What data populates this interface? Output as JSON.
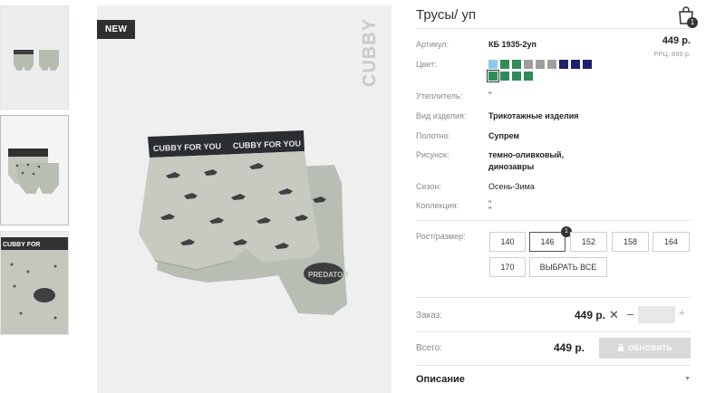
{
  "product": {
    "title": "Трусы/ уп",
    "badge": "NEW",
    "brand_watermark": "CUBBY",
    "waistband_text": "CUBBY FOR YOU",
    "print_badge": "PREDATOR",
    "price": "449 р.",
    "rrp": "РРЦ: 899 р.",
    "cart_count": "1"
  },
  "specs": [
    {
      "label": "Артикул:",
      "value": "КБ 1935-2уп",
      "bold": true
    },
    {
      "label": "Цвет:",
      "value": ""
    },
    {
      "label": "Утеплитель:",
      "value": "\""
    },
    {
      "label": "Вид изделия:",
      "value": "Трикотажные изделия",
      "bold": true
    },
    {
      "label": "Полотно:",
      "value": "Супрем",
      "bold": true
    },
    {
      "label": "Рисунок:",
      "value": "темно-оливковый,",
      "value2": "динозавры",
      "bold": true
    },
    {
      "label": "Сезон:",
      "value": "Осень-Зима"
    },
    {
      "label": "Коллекция:",
      "value": "\"",
      "value2": "\""
    }
  ],
  "colors": [
    {
      "hex": "#8fc7ea"
    },
    {
      "hex": "#2f8b57"
    },
    {
      "hex": "#2f8b57"
    },
    {
      "hex": "#9e9e9e"
    },
    {
      "hex": "#9e9e9e"
    },
    {
      "hex": "#9e9e9e"
    },
    {
      "hex": "#1f1f6b"
    },
    {
      "hex": "#1f1f6b"
    },
    {
      "hex": "#1f1f6b"
    },
    {
      "hex": "#2f8b57",
      "selected": true
    },
    {
      "hex": "#2f8b57"
    },
    {
      "hex": "#2f8b57"
    },
    {
      "hex": "#2f8b57"
    }
  ],
  "sizes": {
    "label": "Рост/размер:",
    "options": [
      "140",
      "146",
      "152",
      "158",
      "164",
      "170"
    ],
    "selected": "146",
    "selected_count": "1",
    "select_all": "ВЫБРАТЬ ВСЕ"
  },
  "order": {
    "label": "Заказ:",
    "price": "449 р.",
    "remove_glyph": "✕",
    "minus": "–",
    "plus": "+",
    "quantity": ""
  },
  "total": {
    "label": "Всего:",
    "price": "449 р.",
    "button": "ОБНОВИТЬ"
  },
  "description": {
    "label": "Описание"
  }
}
